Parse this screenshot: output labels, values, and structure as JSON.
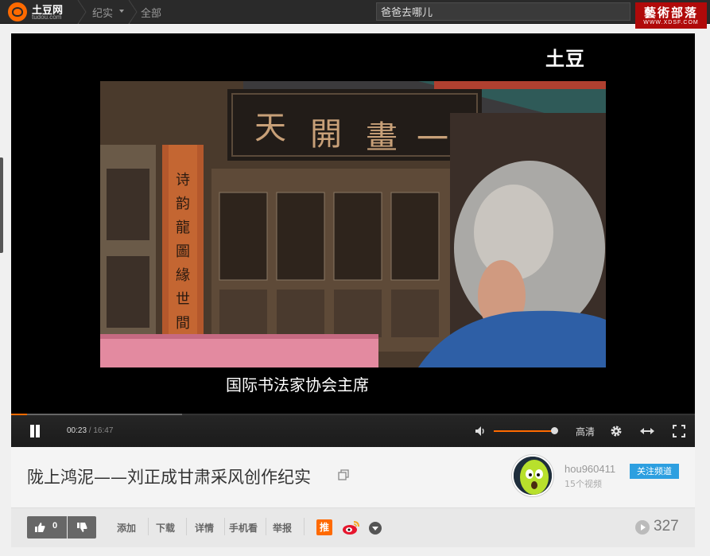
{
  "topbar": {
    "logo_text": "土豆网",
    "logo_sub": "tudou.com",
    "category": "纪实",
    "all": "全部",
    "search_value": "爸爸去哪儿",
    "brand_cn": "藝術部落",
    "brand_en": "WWW.XDSF.COM"
  },
  "player": {
    "watermark": "土豆",
    "subtitle": "国际书法家协会主席",
    "time_current": "00:23",
    "time_separator": " / ",
    "time_total": "16:47",
    "progress_played": 0.023,
    "progress_buffered": 0.25,
    "volume": 0.95,
    "quality_label": "高清",
    "icons": [
      "pause-icon",
      "volume-icon",
      "gear-icon",
      "widen-icon",
      "fullscreen-icon"
    ]
  },
  "info": {
    "title": "陇上鸿泥——刘正成甘肃采风创作纪实",
    "username": "hou960411",
    "video_count": "15个视频",
    "follow_label": "关注频道"
  },
  "actions": {
    "like_count": "0",
    "links": [
      "添加",
      "下载",
      "详情",
      "手机看",
      "举报"
    ],
    "share_tui": "推",
    "views": "327"
  },
  "colors": {
    "accent": "#ff6a00",
    "follow": "#2d9fe0",
    "brand": "#b00a0a"
  }
}
